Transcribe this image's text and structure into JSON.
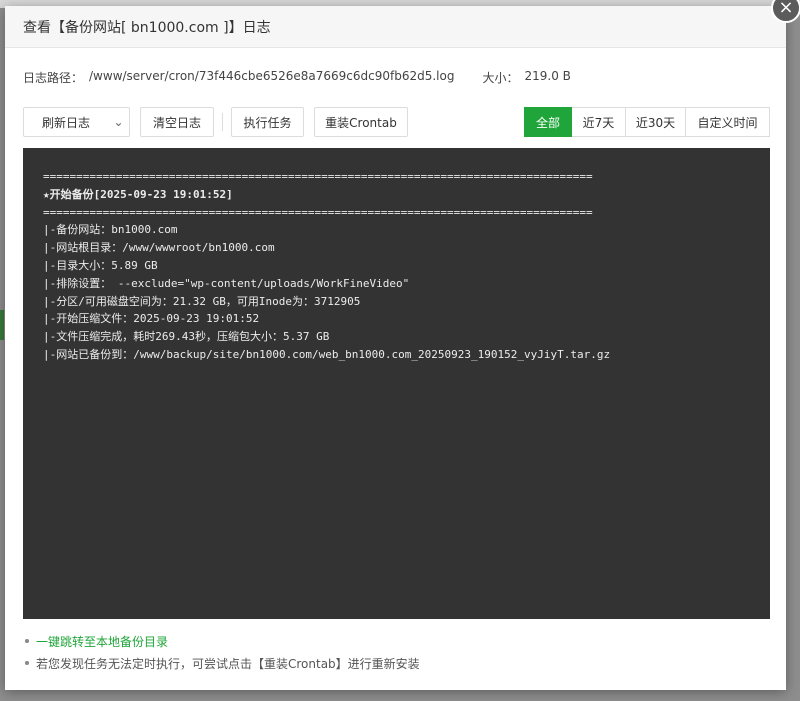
{
  "dialog": {
    "title": "查看【备份网站[ bn1000.com ]】日志",
    "close_glyph": "×"
  },
  "info": {
    "path_label": "日志路径：",
    "path_value": "/www/server/cron/73f446cbe6526e8a7669c6dc90fb62d5.log",
    "size_label": "大小：",
    "size_value": "219.0 B"
  },
  "toolbar": {
    "refresh_label": "刷新日志",
    "caret_glyph": "⌄",
    "clear_label": "清空日志",
    "exec_label": "执行任务",
    "reinstall_label": "重装Crontab",
    "ranges": [
      {
        "label": "全部",
        "active": true
      },
      {
        "label": "近7天",
        "active": false
      },
      {
        "label": "近30天",
        "active": false
      },
      {
        "label": "自定义时间",
        "active": false
      }
    ]
  },
  "log": {
    "lines": [
      "===================================================================================",
      "★开始备份[2025-09-23 19:01:52]",
      "===================================================================================",
      "|-备份网站：bn1000.com",
      "|-网站根目录：/www/wwwroot/bn1000.com",
      "|-目录大小：5.89 GB",
      "|-排除设置： --exclude=\"wp-content/uploads/WorkFineVideo\"",
      "|-分区/可用磁盘空间为：21.32 GB，可用Inode为：3712905",
      "|-开始压缩文件：2025-09-23 19:01:52",
      "|-文件压缩完成，耗时269.43秒，压缩包大小：5.37 GB",
      "|-网站已备份到：/www/backup/site/bn1000.com/web_bn1000.com_20250923_190152_vyJiyT.tar.gz"
    ]
  },
  "tips": {
    "link_label": "一键跳转至本地备份目录",
    "hint": "若您发现任务无法定时执行，可尝试点击【重装Crontab】进行重新安装"
  },
  "colors": {
    "accent": "#20a53a",
    "log_bg": "#333333"
  }
}
